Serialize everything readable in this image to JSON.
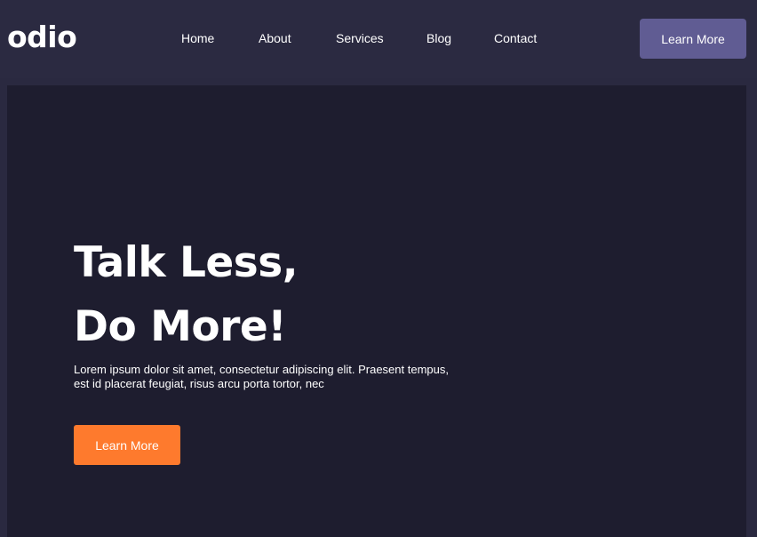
{
  "header": {
    "logo": "odio",
    "nav": {
      "home": "Home",
      "about": "About",
      "services": "Services",
      "blog": "Blog",
      "contact": "Contact"
    },
    "cta_label": "Learn More"
  },
  "hero": {
    "title_line1": "Talk Less,",
    "title_line2": "Do More!",
    "description": "Lorem ipsum dolor sit amet, consectetur adipiscing elit. Praesent tempus, est id placerat feugiat, risus arcu porta tortor, nec",
    "cta_label": "Learn More"
  },
  "colors": {
    "page_background": "#2a2940",
    "header_background": "#2b2a41",
    "hero_background": "#1e1d2f",
    "header_button": "#605c93",
    "hero_button": "#fe7a2d",
    "text": "#ffffff"
  }
}
